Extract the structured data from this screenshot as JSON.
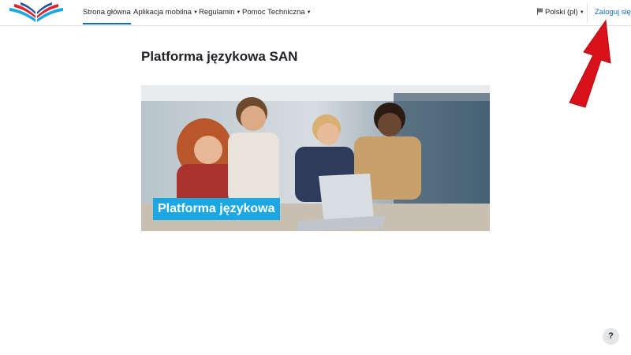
{
  "nav": {
    "items": [
      {
        "label": "Strona główna",
        "active": true,
        "dropdown": false
      },
      {
        "label": "Aplikacja mobilna",
        "active": false,
        "dropdown": true
      },
      {
        "label": "Regulamin",
        "active": false,
        "dropdown": true
      },
      {
        "label": "Pomoc Techniczna",
        "active": false,
        "dropdown": true
      }
    ],
    "language": "Polski ‎(pl)‎",
    "login": "Zaloguj się"
  },
  "main": {
    "title": "Platforma językowa SAN",
    "banner_label": "Platforma językowa"
  },
  "help": {
    "label": "?"
  },
  "colors": {
    "accent": "#0f6cbf",
    "banner_label_bg": "#1aa7e3",
    "arrow": "#e01b1b"
  },
  "icons": {
    "logo": "book-logo",
    "language": "language-icon",
    "help": "question-icon",
    "annotation": "red-arrow"
  }
}
